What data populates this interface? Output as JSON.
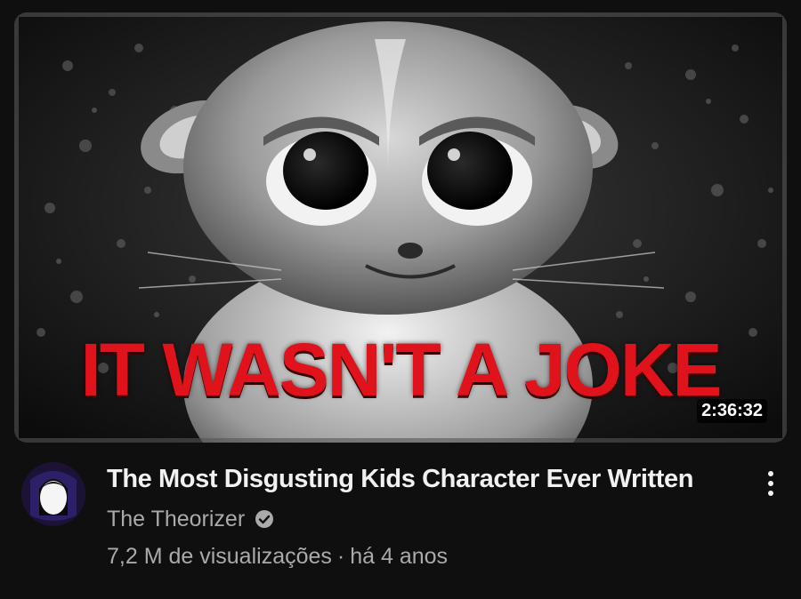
{
  "video": {
    "thumbnail_text": "IT WASN'T A JOKE",
    "duration": "2:36:32",
    "title": "The Most Disgusting Kids Character Ever Written",
    "channel": "The Theorizer",
    "views": "7,2 M de visualizações",
    "separator": "·",
    "age": "há 4 anos"
  },
  "icons": {
    "verified": "verified-check-icon",
    "menu": "more-vertical-icon",
    "avatar": "channel-avatar"
  },
  "colors": {
    "background": "#0f0f0f",
    "title_text": "#f1f1f1",
    "secondary_text": "#aaaaaa",
    "thumbnail_accent": "#e0121b"
  }
}
